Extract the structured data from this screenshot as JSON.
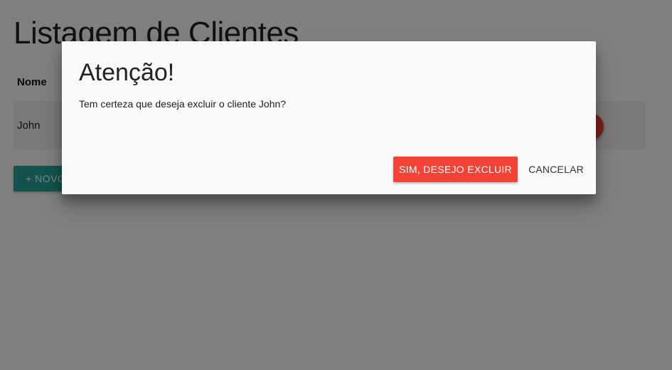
{
  "page": {
    "title": "Listagem de Clientes",
    "table": {
      "columns": [
        "Nome"
      ],
      "rows": [
        {
          "name": "John"
        }
      ]
    },
    "new_button_label": "+ NOVO"
  },
  "modal": {
    "title": "Atenção!",
    "message": "Tem certeza que deseja excluir o cliente John?",
    "confirm_label": "SIM, DESEJO EXCLUIR",
    "cancel_label": "CANCELAR"
  },
  "colors": {
    "accent_teal": "#26a69a",
    "danger_red": "#f44336",
    "overlay": "rgba(0,0,0,0.5)"
  },
  "icons": {
    "delete_button": "delete-icon"
  }
}
